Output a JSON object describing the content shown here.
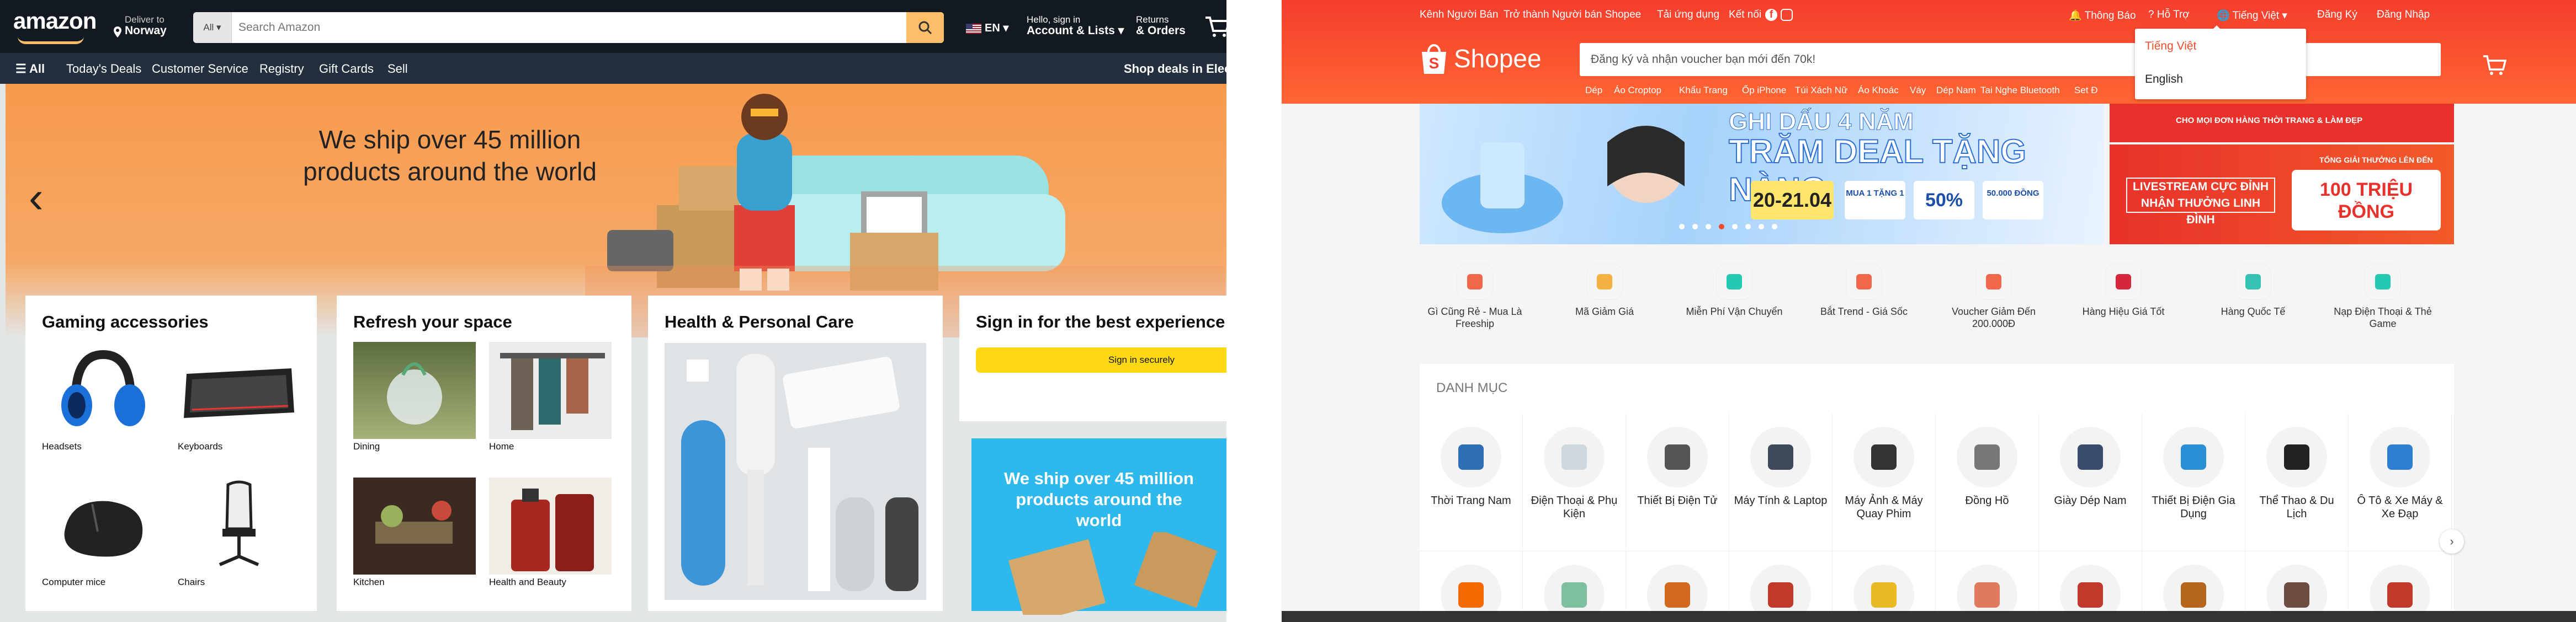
{
  "amazon": {
    "logo": "amazon",
    "deliver_label": "Deliver to",
    "deliver_location": "Norway",
    "search_category": "All",
    "search_placeholder": "Search Amazon",
    "language": "EN",
    "account_hello": "Hello, sign in",
    "account_lists": "Account & Lists",
    "returns": "Returns",
    "orders": "& Orders",
    "nav": [
      "All",
      "Today's Deals",
      "Customer Service",
      "Registry",
      "Gift Cards",
      "Sell"
    ],
    "nav_right": "Shop deals in Electronics",
    "hero_text": "We ship over 45 million products around the world",
    "cards": {
      "gaming": {
        "title": "Gaming accessories",
        "items": [
          "Headsets",
          "Keyboards",
          "Computer mice",
          "Chairs"
        ]
      },
      "refresh": {
        "title": "Refresh your space",
        "items": [
          "Dining",
          "Home",
          "Kitchen",
          "Health and Beauty"
        ]
      },
      "health": {
        "title": "Health & Personal Care"
      },
      "signin": {
        "title": "Sign in for the best experience",
        "button": "Sign in securely"
      }
    },
    "ship_card_text": "We ship over 45 million products around the world",
    "colors": {
      "header": "#131921",
      "nav": "#232f3e",
      "accent": "#febd69",
      "signin_button": "#ffd814"
    }
  },
  "shopee": {
    "top_left": [
      "Kênh Người Bán",
      "Trở thành Người bán Shopee",
      "Tải ứng dụng",
      "Kết nối"
    ],
    "top_right": [
      "Thông Báo",
      "Hỗ Trợ",
      "Tiếng Việt",
      "Đăng Ký",
      "Đăng Nhập"
    ],
    "logo": "Shopee",
    "search_placeholder": "Đăng ký và nhận voucher bạn mới đến 70k!",
    "suggestions": [
      "Dép",
      "Áo Croptop",
      "Khẩu Trang",
      "Ốp iPhone",
      "Túi Xách Nữ",
      "Áo Khoác",
      "Váy",
      "Dép Nam",
      "Tai Nghe Bluetooth",
      "Set Đ"
    ],
    "language_menu": [
      "Tiếng Việt",
      "English"
    ],
    "banner": {
      "line1": "GHI DẤU 4 NĂM",
      "line2": "TRĂM DEAL TẶNG NÀNG",
      "date": "20-21.04",
      "badge1": "MUA 1 TẶNG 1",
      "badge2": "50%",
      "badge3": "50.000 ĐỒNG"
    },
    "side_banner_top": "CHO MỌI ĐƠN HÀNG THỜI TRANG & LÀM ĐẸP",
    "side_banner": {
      "left": "LIVESTREAM CỰC ĐỈNH NHẬN THƯỞNG LINH ĐÌNH",
      "label": "TỔNG GIẢI THƯỞNG LÊN ĐẾN",
      "amount": "100 TRIỆU ĐỒNG"
    },
    "quick_links": [
      "Gì Cũng Rẻ - Mua Là Freeship",
      "Mã Giảm Giá",
      "Miễn Phí Vận Chuyển",
      "Bắt Trend - Giá Sốc",
      "Voucher Giảm Đến 200.000Đ",
      "Hàng Hiệu Giá Tốt",
      "Hàng Quốc Tế",
      "Nạp Điện Thoại & Thẻ Game"
    ],
    "category_heading": "DANH MỤC",
    "categories": [
      "Thời Trang Nam",
      "Điện Thoại & Phụ Kiện",
      "Thiết Bị Điện Tử",
      "Máy Tính & Laptop",
      "Máy Ảnh & Máy Quay Phim",
      "Đồng Hồ",
      "Giày Dép Nam",
      "Thiết Bị Điện Gia Dụng",
      "Thể Thao & Du Lịch",
      "Ô Tô & Xe Máy & Xe Đạp"
    ],
    "colors": {
      "brand": "#ee4d2d"
    }
  }
}
